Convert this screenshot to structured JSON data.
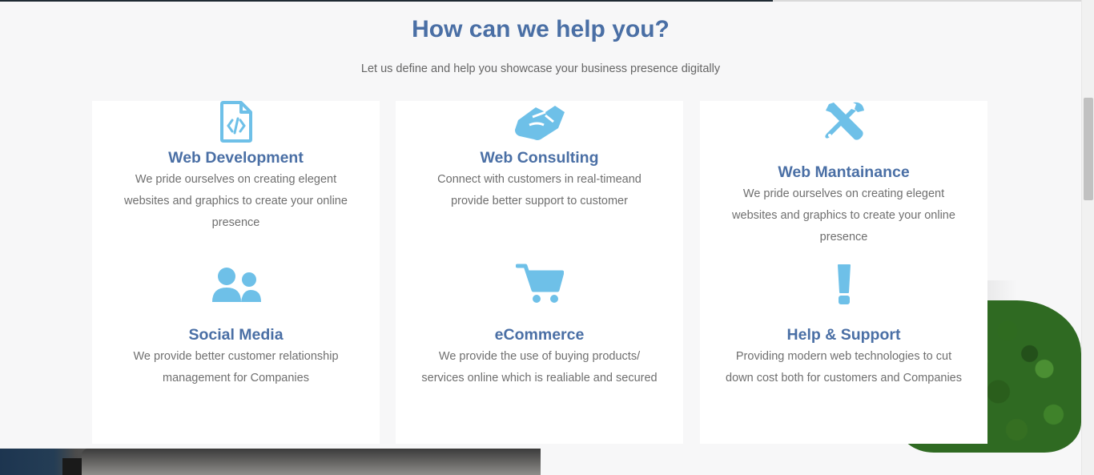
{
  "header": {
    "title": "How can we help you?",
    "subtitle": "Let us define and help you showcase your business presence digitally"
  },
  "services": [
    {
      "title": "Web Development",
      "description": "We pride ourselves on creating elegent websites and graphics to create your online presence",
      "icon": "code-file-icon"
    },
    {
      "title": "Web Consulting",
      "description": "Connect with customers in real-timeand provide better support to customer",
      "icon": "handshake-icon"
    },
    {
      "title": "Web Mantainance",
      "description": "We pride ourselves on creating elegent websites and graphics to create your online presence",
      "icon": "tools-icon"
    },
    {
      "title": "Social Media",
      "description": "We provide better customer relationship management for Companies",
      "icon": "users-icon"
    },
    {
      "title": "eCommerce",
      "description": "We provide the use of buying products/ services online which is realiable and secured",
      "icon": "shopping-cart-icon"
    },
    {
      "title": "Help & Support",
      "description": "Providing modern web technologies to cut down cost both for customers and Companies",
      "icon": "exclamation-icon"
    }
  ],
  "colors": {
    "accent": "#4a6fa5",
    "icon": "#6ec0e8",
    "text": "#6f6f6f",
    "background": "#f7f7f8",
    "card": "#ffffff"
  }
}
